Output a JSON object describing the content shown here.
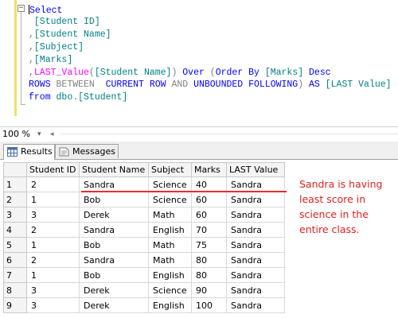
{
  "editor": {
    "collapse_glyph": "−",
    "lines": [
      [
        {
          "t": "Select",
          "c": "kw"
        }
      ],
      [
        {
          "t": " [Student ID]",
          "c": "id"
        }
      ],
      [
        {
          "t": ",",
          "c": "gr"
        },
        {
          "t": "[Student Name]",
          "c": "id"
        }
      ],
      [
        {
          "t": ",",
          "c": "gr"
        },
        {
          "t": "[Subject]",
          "c": "id"
        }
      ],
      [
        {
          "t": ",",
          "c": "gr"
        },
        {
          "t": "[Marks]",
          "c": "id"
        }
      ],
      [
        {
          "t": ",",
          "c": "gr"
        },
        {
          "t": "LAST_Value",
          "c": "fn"
        },
        {
          "t": "(",
          "c": "gr"
        },
        {
          "t": "[Student Name]",
          "c": "id"
        },
        {
          "t": ")",
          "c": "gr"
        },
        {
          "t": " Over ",
          "c": "kw"
        },
        {
          "t": "(",
          "c": "gr"
        },
        {
          "t": "Order By ",
          "c": "kw"
        },
        {
          "t": "[Marks]",
          "c": "id"
        },
        {
          "t": " Desc",
          "c": "kw"
        }
      ],
      [
        {
          "t": "ROWS ",
          "c": "kw"
        },
        {
          "t": "BETWEEN",
          "c": "gr"
        },
        {
          "t": "  CURRENT ROW ",
          "c": "kw"
        },
        {
          "t": "AND",
          "c": "gr"
        },
        {
          "t": " UNBOUNDED FOLLOWING",
          "c": "kw"
        },
        {
          "t": ") ",
          "c": "gr"
        },
        {
          "t": "AS ",
          "c": "kw"
        },
        {
          "t": "[LAST Value]",
          "c": "id"
        }
      ],
      [
        {
          "t": "from ",
          "c": "kw"
        },
        {
          "t": "dbo",
          "c": "id"
        },
        {
          "t": ".",
          "c": "gr"
        },
        {
          "t": "[Student]",
          "c": "id"
        }
      ]
    ]
  },
  "zoom": {
    "value": "100 %",
    "dropdown_glyph": "▾",
    "scroll_glyph": "◂"
  },
  "tabs": {
    "results": "Results",
    "messages": "Messages"
  },
  "grid": {
    "columns": [
      "",
      "Student ID",
      "Student Name",
      "Subject",
      "Marks",
      "LAST Value"
    ],
    "rows": [
      [
        "1",
        "2",
        "Sandra",
        "Science",
        "40",
        "Sandra"
      ],
      [
        "2",
        "1",
        "Bob",
        "Science",
        "60",
        "Sandra"
      ],
      [
        "3",
        "3",
        "Derek",
        "Math",
        "60",
        "Sandra"
      ],
      [
        "4",
        "2",
        "Sandra",
        "English",
        "70",
        "Sandra"
      ],
      [
        "5",
        "1",
        "Bob",
        "Math",
        "75",
        "Sandra"
      ],
      [
        "6",
        "2",
        "Sandra",
        "Math",
        "80",
        "Sandra"
      ],
      [
        "7",
        "1",
        "Bob",
        "English",
        "80",
        "Sandra"
      ],
      [
        "8",
        "3",
        "Derek",
        "Science",
        "90",
        "Sandra"
      ],
      [
        "9",
        "3",
        "Derek",
        "English",
        "100",
        "Sandra"
      ]
    ]
  },
  "annotation": {
    "lines": [
      "Sandra is having",
      "least score in",
      "science in the",
      "entire class."
    ],
    "color": "#e02020"
  },
  "colors": {
    "keyword": "#0000ff",
    "function": "#ff00ff",
    "identifier": "#008080",
    "operator": "#808080",
    "gutter": "#f2e25a",
    "underline": "#ee2b2b"
  }
}
